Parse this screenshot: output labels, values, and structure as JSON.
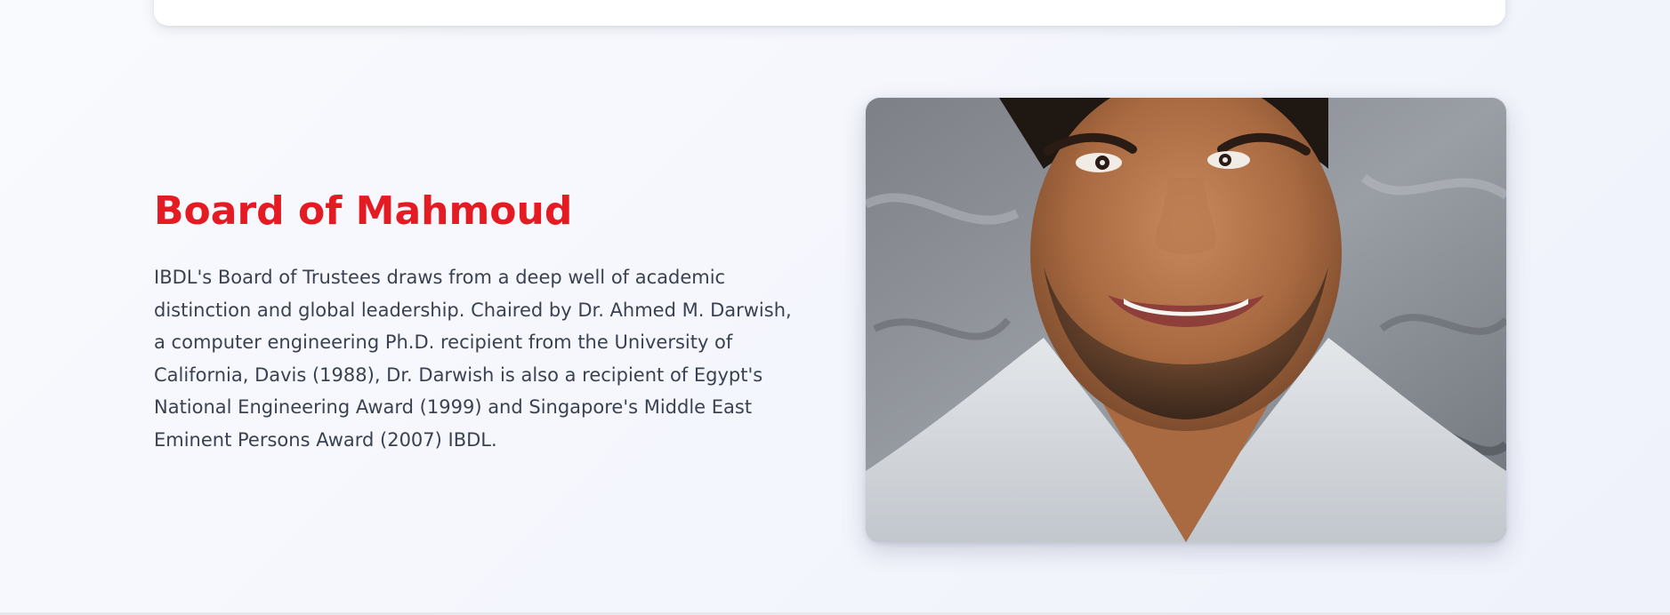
{
  "section": {
    "title": "Board of Mahmoud",
    "description": "IBDL's Board of Trustees draws from a deep well of academic distinction and global leadership. Chaired by Dr. Ahmed M. Darwish, a computer engineering Ph.D. recipient from the University of California, Davis (1988), Dr. Darwish is also a recipient of Egypt's National Engineering Award (1999) and Singapore's Middle East Eminent Persons Award (2007) IBDL.",
    "image": {
      "icon": "portrait-photo"
    }
  },
  "colors": {
    "accent": "#e41b23",
    "text": "#3a4150",
    "background": "#f6f7fd"
  }
}
